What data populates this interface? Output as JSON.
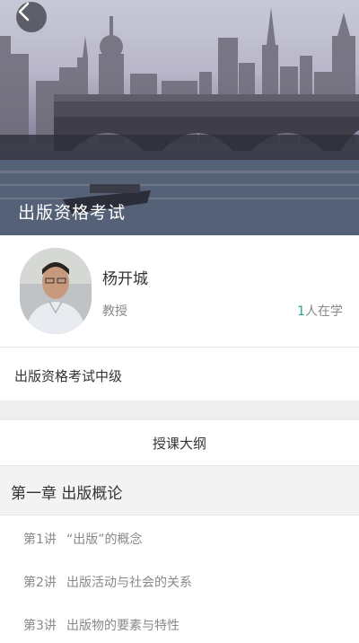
{
  "header": {
    "title": "出版资格考试",
    "back_icon": "chevron-left-icon"
  },
  "teacher": {
    "name": "杨开城",
    "role": "教授",
    "count": "1",
    "count_suffix": "人在学"
  },
  "course": {
    "name": "出版资格考试中级"
  },
  "syllabus": {
    "heading": "授课大纲",
    "chapter": "第一章  出版概论",
    "lectures": [
      {
        "num": "第1讲",
        "title": "“出版”的概念"
      },
      {
        "num": "第2讲",
        "title": "出版活动与社会的关系"
      },
      {
        "num": "第3讲",
        "title": "出版物的要素与特性"
      }
    ]
  },
  "colors": {
    "accent": "#26a69a",
    "divider": "#eeeeee"
  }
}
